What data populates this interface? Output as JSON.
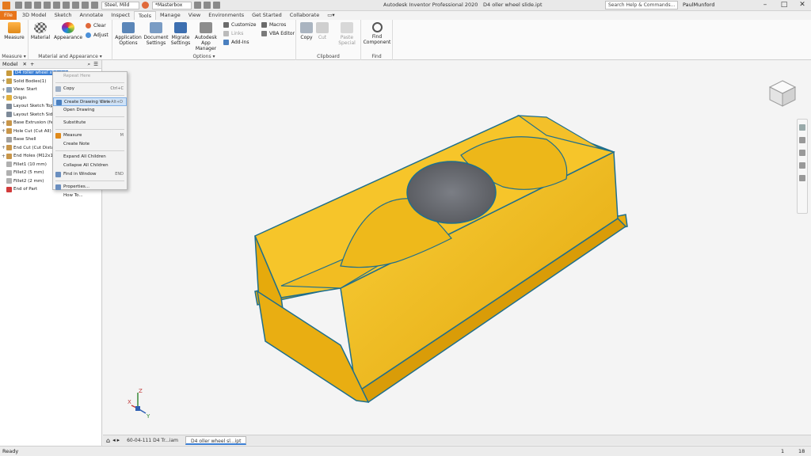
{
  "titlebar": {
    "material": "Steel, Mild",
    "appearance": "*Masterbox",
    "title": "Autodesk Inventor Professional 2020",
    "document": "D4 oller wheel slide.ipt",
    "search_placeholder": "Search Help & Commands...",
    "user": "PaulMunford"
  },
  "ribbon_tabs": [
    "File",
    "3D Model",
    "Sketch",
    "Annotate",
    "Inspect",
    "Tools",
    "Manage",
    "View",
    "Environments",
    "Get Started",
    "Collaborate"
  ],
  "ribbon": {
    "measure": {
      "measure_label": "Measure",
      "panel_label": "Measure ▾"
    },
    "material_appearance": {
      "material_label": "Material",
      "appearance_label": "Appearance",
      "clear_label": "Clear",
      "adjust_label": "Adjust",
      "panel_label": "Material and Appearance ▾"
    },
    "options": {
      "app_options_label": "Application\nOptions",
      "doc_settings_label": "Document\nSettings",
      "migrate_label": "Migrate\nSettings",
      "app_manager_label": "Autodesk\nApp Manager",
      "customize_label": "Customize",
      "links_label": "Links",
      "addins_label": "Add-Ins",
      "macros_label": "Macros",
      "vba_label": "VBA Editor",
      "panel_label": "Options ▾"
    },
    "clipboard": {
      "copy_label": "Copy",
      "cut_label": "Cut",
      "paste_label": "Paste\nSpecial",
      "panel_label": "Clipboard"
    },
    "find": {
      "find_label": "Find\nComponent",
      "panel_label": "Find"
    }
  },
  "browser": {
    "title": "Model",
    "items": [
      {
        "label": "D4 roller wheel slide.ipt",
        "exp": ""
      },
      {
        "label": "Solid Bodies(1)",
        "exp": "+"
      },
      {
        "label": "View: Start",
        "exp": "+"
      },
      {
        "label": "Origin",
        "exp": "+"
      },
      {
        "label": "Layout Sketch Top",
        "exp": ""
      },
      {
        "label": "Layout Sketch Side",
        "exp": ""
      },
      {
        "label": "Base Extrusion (fe...",
        "exp": "+"
      },
      {
        "label": "Hole Cut (Cut All)",
        "exp": "+"
      },
      {
        "label": "Base Shell",
        "exp": ""
      },
      {
        "label": "End Cut (Cut Dista...",
        "exp": "+"
      },
      {
        "label": "End Holes (M12x1...",
        "exp": "+"
      },
      {
        "label": "Fillet1 (10 mm)",
        "exp": ""
      },
      {
        "label": "Fillet2 (5 mm)",
        "exp": ""
      },
      {
        "label": "Fillet2 (2 mm)",
        "exp": ""
      },
      {
        "label": "End of Part",
        "exp": ""
      }
    ]
  },
  "context_menu": {
    "items": [
      {
        "label": "Repeat Here",
        "shortcut": "",
        "disabled": true
      },
      {
        "label": "Copy",
        "shortcut": "Ctrl+C",
        "disabled": false
      },
      {
        "label": "Create Drawing View",
        "shortcut": "Ctrl+Alt+D",
        "disabled": false
      },
      {
        "label": "Open Drawing",
        "shortcut": "",
        "disabled": false
      },
      {
        "label": "Substitute",
        "shortcut": "",
        "disabled": false
      },
      {
        "label": "Measure",
        "shortcut": "M",
        "disabled": false
      },
      {
        "label": "Create Note",
        "shortcut": "",
        "disabled": false
      },
      {
        "label": "Expand All Children",
        "shortcut": "",
        "disabled": false
      },
      {
        "label": "Collapse All Children",
        "shortcut": "",
        "disabled": false
      },
      {
        "label": "Find in Window",
        "shortcut": "END",
        "disabled": false
      },
      {
        "label": "Properties...",
        "shortcut": "",
        "disabled": false
      },
      {
        "label": "How To...",
        "shortcut": "",
        "disabled": false
      }
    ]
  },
  "doc_tabs": [
    "60-04-111 D4 Tr...iam",
    "D4 oller wheel sl...ipt"
  ],
  "status": {
    "text": "Ready",
    "count_a": "1",
    "count_b": "18"
  },
  "triad": {
    "x": "X",
    "y": "Y",
    "z": "Z"
  },
  "colors": {
    "part_fill": "#f2b915",
    "part_edge": "#1f6f8c",
    "hole": "#6a6d73",
    "accent": "#e8741a",
    "selection": "#3b7fd4"
  }
}
